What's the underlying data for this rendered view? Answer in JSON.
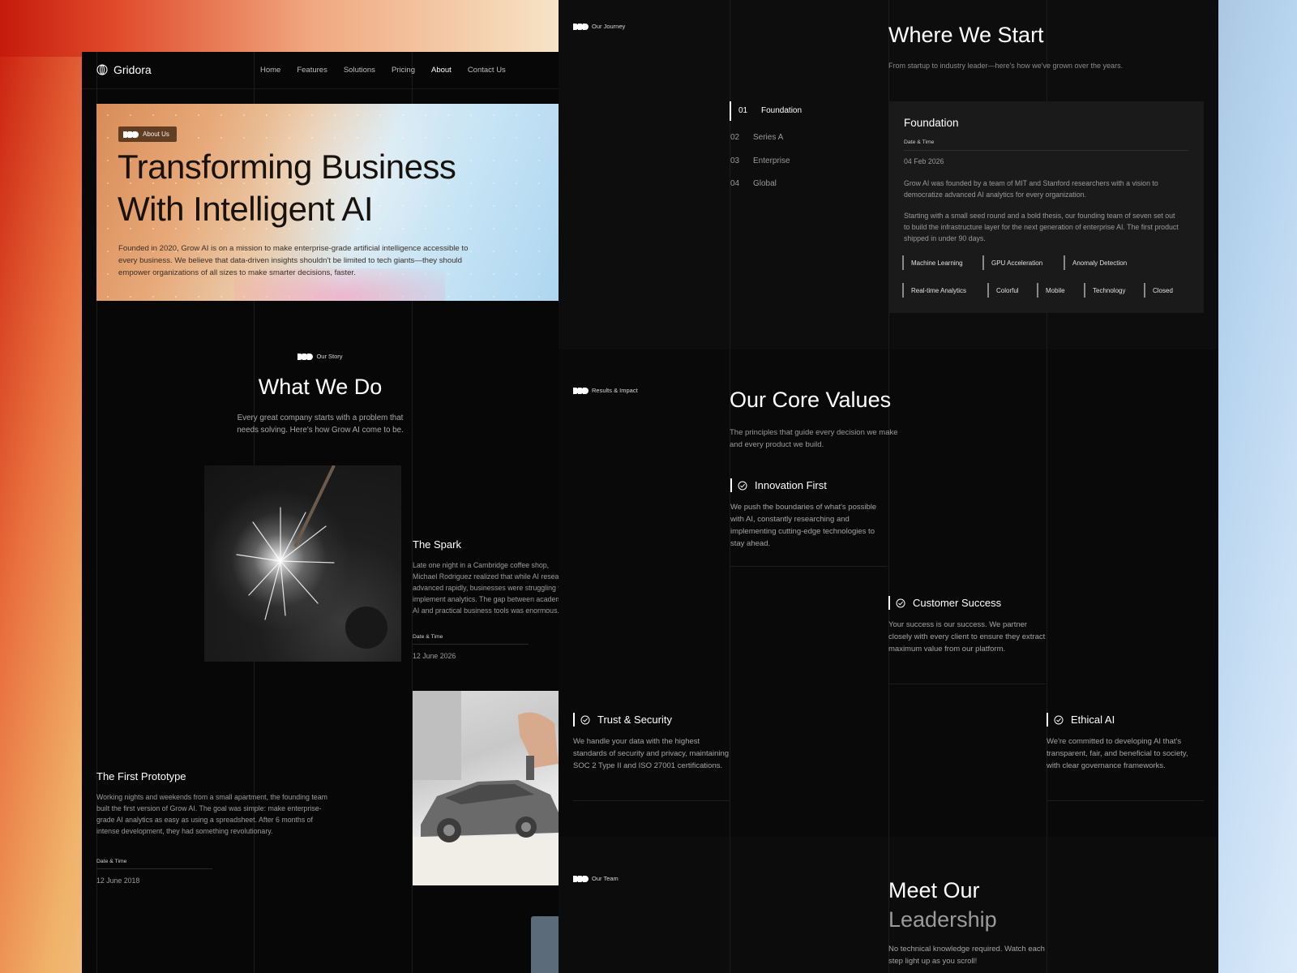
{
  "brand": {
    "name": "Gridora"
  },
  "nav": {
    "items": [
      {
        "label": "Home",
        "active": false
      },
      {
        "label": "Features",
        "active": false
      },
      {
        "label": "Solutions",
        "active": false
      },
      {
        "label": "Pricing",
        "active": false
      },
      {
        "label": "About",
        "active": true
      },
      {
        "label": "Contact Us",
        "active": false
      }
    ]
  },
  "hero": {
    "badge": "About Us",
    "title_line1": "Transforming Business",
    "title_line2": "With Intelligent AI",
    "description": "Founded in 2020, Grow AI is on a mission to make enterprise-grade artificial intelligence accessible to every business. We believe that data-driven insights shouldn't be limited to tech giants—they should empower organizations of all sizes to make smarter decisions, faster."
  },
  "story": {
    "label": "Our Story",
    "title": "What We Do",
    "subtitle": "Every great company starts with a problem that needs solving. Here's how Grow AI come to be.",
    "cards": [
      {
        "title": "The Spark",
        "description": "Late one night in a Cambridge coffee shop, Michael Rodriguez realized that while AI research advanced rapidly, businesses were struggling to implement analytics. The gap between academic AI and practical business tools was enormous.",
        "meta_label": "Date & Time",
        "meta_value": "12 June 2026"
      },
      {
        "title": "The First Prototype",
        "description": "Working nights and weekends from a small apartment, the founding team built the first version of Grow AI. The goal was simple: make enterprise-grade AI analytics as easy as using a spreadsheet. After 6 months of intense development, they had something revolutionary.",
        "meta_label": "Date & Time",
        "meta_value": "12 June 2018"
      }
    ]
  },
  "journey": {
    "label": "Our Journey",
    "title": "Where We Start",
    "subtitle": "From startup to industry leader—here's how we've grown over the years.",
    "steps": [
      {
        "num": "01",
        "label": "Foundation",
        "active": true
      },
      {
        "num": "02",
        "label": "Series A",
        "active": false
      },
      {
        "num": "03",
        "label": "Enterprise",
        "active": false
      },
      {
        "num": "04",
        "label": "Global",
        "active": false
      }
    ],
    "detail": {
      "title": "Foundation",
      "meta_label": "Date & Time",
      "date": "04 Feb 2026",
      "paragraph1": "Grow AI was founded by a team of MIT and Stanford researchers with a vision to democratize advanced AI analytics for every organization.",
      "paragraph2": "Starting with a small seed round and a bold thesis, our founding team of seven set out to build the infrastructure layer for the next generation of enterprise AI. The first product shipped in under 90 days.",
      "tags": [
        "Machine Learning",
        "GPU Acceleration",
        "Anomaly Detection",
        "Real-time Analytics",
        "Colorful",
        "Mobile",
        "Technology",
        "Closed"
      ]
    }
  },
  "values": {
    "label": "Results & Impact",
    "title": "Our Core Values",
    "subtitle": "The principles that guide every decision we make and every product we build.",
    "items": [
      {
        "title": "Innovation First",
        "description": "We push the boundaries of what's possible with AI, constantly researching and implementing cutting-edge technologies to stay ahead."
      },
      {
        "title": "Customer Success",
        "description": "Your success is our success. We partner closely with every client to ensure they extract maximum value from our platform."
      },
      {
        "title": "Trust & Security",
        "description": "We handle your data with the highest standards of security and privacy, maintaining SOC 2 Type II and ISO 27001 certifications."
      },
      {
        "title": "Ethical AI",
        "description": "We're committed to developing AI that's transparent, fair, and beneficial to society, with clear governance frameworks."
      }
    ]
  },
  "team": {
    "label": "Our Team",
    "title_line1": "Meet Our",
    "title_line2": "Leadership",
    "subtitle": "No technical knowledge required. Watch each step light up as you scroll!"
  }
}
